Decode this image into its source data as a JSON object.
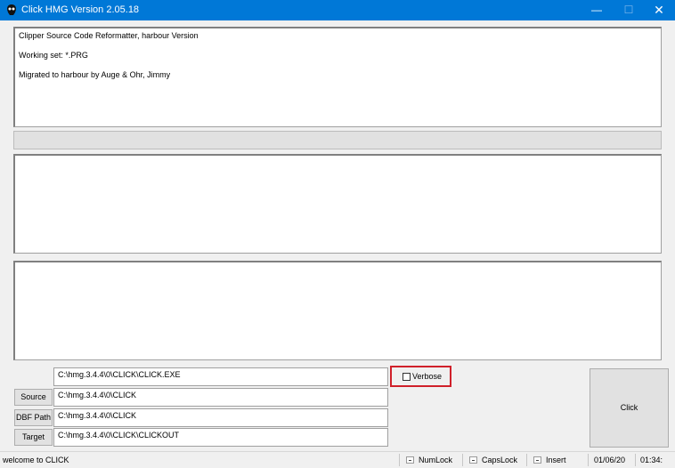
{
  "window": {
    "title": "Click HMG Version 2.05.18",
    "accent": "#0078d7"
  },
  "info_panel": {
    "lines": [
      "Clipper Source Code Reformatter,  harbour Version",
      "Working set: *.PRG",
      "Migrated to harbour by Auge & Ohr, Jimmy"
    ]
  },
  "fields": {
    "exe": "C:\\hmg.3.4.4\\0\\CLICK\\CLICK.EXE",
    "source": "C:\\hmg.3.4.4\\0\\CLICK",
    "dbf_path": "C:\\hmg.3.4.4\\0\\CLICK",
    "target": "C:\\hmg.3.4.4\\0\\CLICK\\CLICKOUT"
  },
  "buttons": {
    "source": "Source",
    "dbf_path": "DBF Path",
    "target": "Target",
    "click": "Click"
  },
  "verbose": {
    "label": "Verbose",
    "checked": false
  },
  "statusbar": {
    "message": "welcome to CLICK",
    "numlock": "NumLock",
    "capslock": "CapsLock",
    "insert": "Insert",
    "date": "01/06/20",
    "time": "01:34:"
  }
}
